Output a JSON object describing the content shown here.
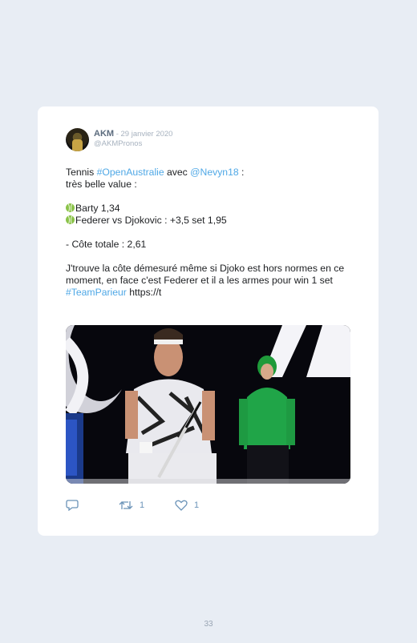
{
  "tweet": {
    "author_name": "AKM",
    "date": " - 29 janvier 2020",
    "handle": "@AKMPronos",
    "text": {
      "tennis": "Tennis ",
      "tag_open": "#OpenAustralie",
      "avec": " avec ",
      "mention": "@Nevyn18",
      "colon": " :",
      "line2": "très belle value :",
      "bet1": "Barty 1,34",
      "bet2": "Federer vs Djokovic : +3,5 set 1,95",
      "total": "- Côte totale : 2,61",
      "comment": "J'trouve la côte démesuré même si Djoko est hors normes en ce moment, en face c'est Federer et il a les armes pour win 1 set",
      "tag_team": "#TeamParieur",
      "link": " https://t"
    },
    "actions": {
      "retweet_count": "1",
      "like_count": "1"
    }
  },
  "page_number": "33",
  "colors": {
    "background": "#e8edf4",
    "card": "#ffffff",
    "hashtag": "#4fa8e6",
    "icon": "#6b93b8"
  },
  "icons": [
    "reply-icon",
    "retweet-icon",
    "heart-icon",
    "tennis-ball-icon"
  ]
}
